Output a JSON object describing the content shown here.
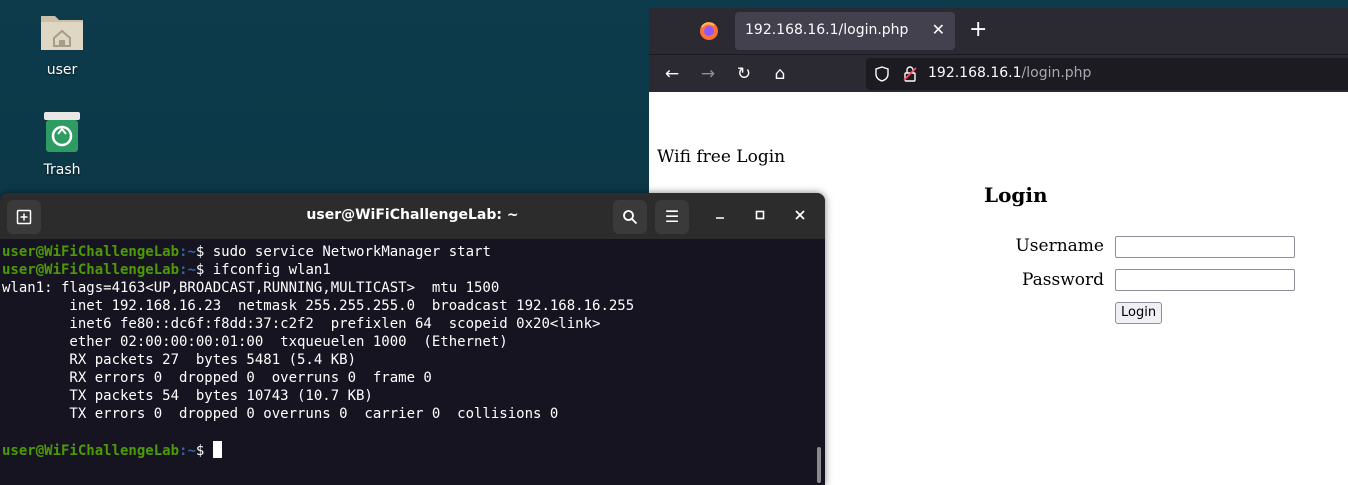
{
  "desktop": {
    "icons": [
      {
        "label": "user",
        "icon": "home-folder-icon"
      },
      {
        "label": "Trash",
        "icon": "trash-icon"
      }
    ]
  },
  "browser": {
    "tab_title": "192.168.16.1/login.php",
    "new_tab": "+",
    "url_host": "192.168.16.1",
    "url_path": "/login.php",
    "page": {
      "title_text": "Wifi free Login",
      "heading": "Login",
      "username_label": "Username",
      "password_label": "Password",
      "username_value": "",
      "password_value": "",
      "login_button": "Login"
    }
  },
  "terminal": {
    "title": "user@WiFiChallengeLab: ~",
    "prompt_user": "user@WiFiChallengeLab",
    "prompt_path": ":~",
    "prompt_symbol": "$",
    "commands": [
      "sudo service NetworkManager start",
      "ifconfig wlan1"
    ],
    "output": [
      "wlan1: flags=4163<UP,BROADCAST,RUNNING,MULTICAST>  mtu 1500",
      "        inet 192.168.16.23  netmask 255.255.255.0  broadcast 192.168.16.255",
      "        inet6 fe80::dc6f:f8dd:37:c2f2  prefixlen 64  scopeid 0x20<link>",
      "        ether 02:00:00:00:01:00  txqueuelen 1000  (Ethernet)",
      "        RX packets 27  bytes 5481 (5.4 KB)",
      "        RX errors 0  dropped 0  overruns 0  frame 0",
      "        TX packets 54  bytes 10743 (10.7 KB)",
      "        TX errors 0  dropped 0 overruns 0  carrier 0  collisions 0"
    ]
  },
  "colors": {
    "desktop_bg": "#0c3a4a",
    "terminal_bg": "#171421",
    "prompt_user": "#4e9a06",
    "prompt_path": "#3465a4",
    "browser_chrome": "#2b2a33"
  }
}
